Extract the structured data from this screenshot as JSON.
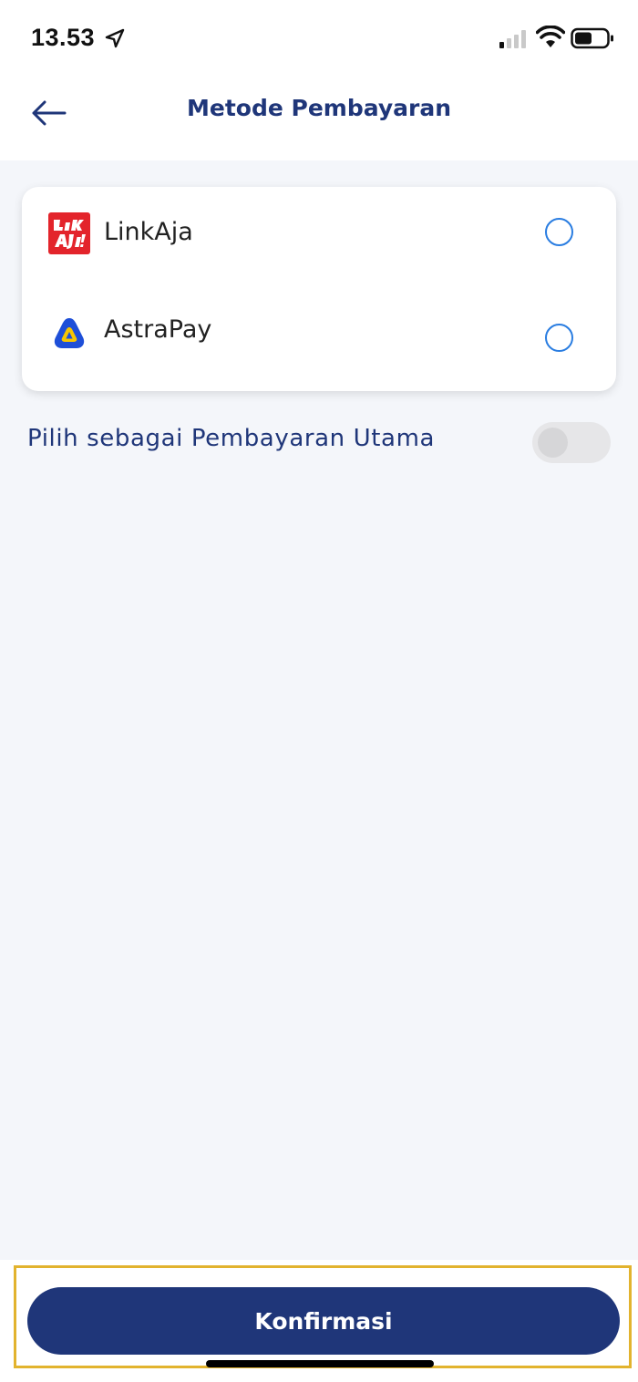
{
  "status_bar": {
    "time": "13.53"
  },
  "header": {
    "title": "Metode Pembayaran"
  },
  "payment_methods": [
    {
      "label": "LinkAja",
      "icon": "linkaja-logo",
      "selected": false
    },
    {
      "label": "AstraPay",
      "icon": "astrapay-logo",
      "selected": false
    }
  ],
  "primary_payment": {
    "label": "Pilih sebagai Pembayaran Utama",
    "enabled": false
  },
  "footer": {
    "confirm_label": "Konfirmasi"
  },
  "colors": {
    "brand": "#1f3679",
    "radio": "#2a7de1",
    "highlight": "#e2b32e",
    "linkaja": "#e3242b",
    "astrapay": "#1e4fd8"
  }
}
